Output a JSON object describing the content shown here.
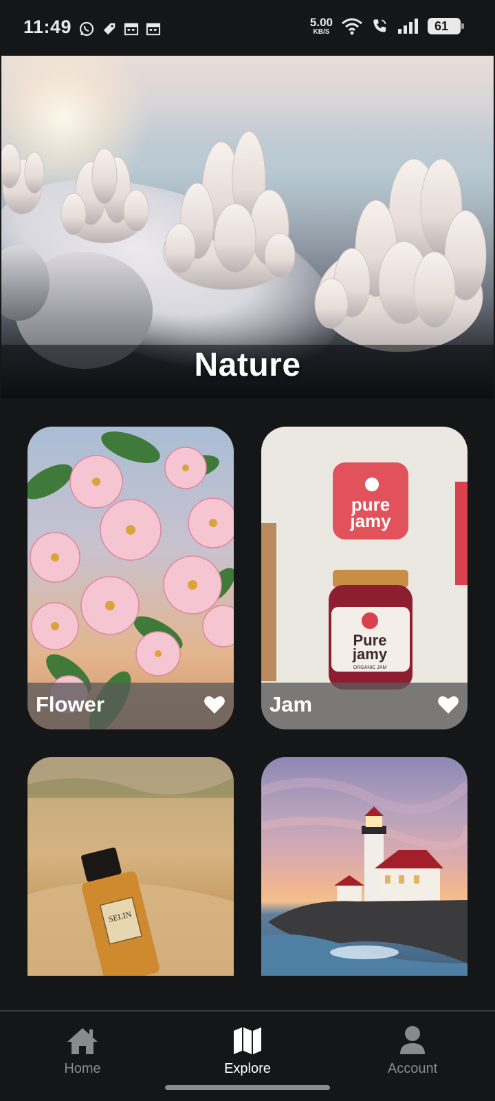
{
  "status_bar": {
    "time": "11:49",
    "network_speed": "5.00",
    "network_speed_unit": "KB/S",
    "battery_level": "61",
    "left_icons": [
      "whatsapp-icon",
      "tag-icon",
      "calendar-icon",
      "calendar-icon"
    ],
    "right_icons": [
      "wifi-icon",
      "call-icon",
      "signal-icon",
      "battery-icon"
    ]
  },
  "hero": {
    "title": "Nature"
  },
  "cards": [
    {
      "label": "Flower",
      "favorite": true
    },
    {
      "label": "Jam",
      "favorite": true
    },
    {
      "label": "",
      "favorite": false
    },
    {
      "label": "",
      "favorite": false
    }
  ],
  "jam_brand": {
    "logo_line1": "pure",
    "logo_line2": "jamy",
    "jar_line1": "Pure",
    "jar_line2": "jamy",
    "jar_sub": "ORGANIC JAM"
  },
  "perfume_label": "SELIN",
  "bottom_nav": {
    "items": [
      {
        "label": "Home",
        "icon": "home-icon",
        "active": false
      },
      {
        "label": "Explore",
        "icon": "map-icon",
        "active": true
      },
      {
        "label": "Account",
        "icon": "user-icon",
        "active": false
      }
    ]
  },
  "colors": {
    "background": "#151618",
    "caption_overlay": "#5a5a5a",
    "nav_inactive": "#8a8a8a",
    "nav_active": "#ffffff"
  }
}
